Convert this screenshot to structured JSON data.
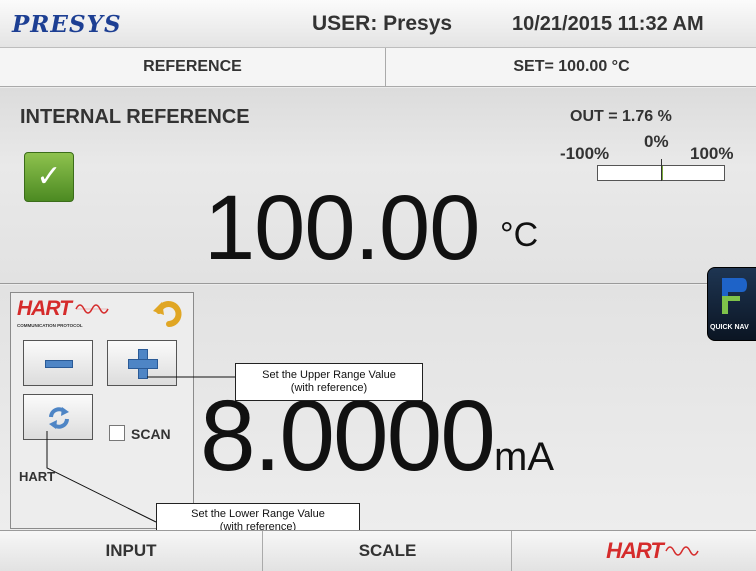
{
  "header": {
    "brand": "PRESYS",
    "user": "USER: Presys",
    "datetime": "10/21/2015 11:32 AM"
  },
  "subbar": {
    "reference_label": "REFERENCE",
    "set_label": "SET= 100.00 °C"
  },
  "reference": {
    "title": "INTERNAL REFERENCE",
    "value": "100.00",
    "unit": "°C",
    "out_label": "OUT = 1.76 %",
    "out_percent": 1.76,
    "scale_min": "-100%",
    "scale_zero": "0%",
    "scale_max": "100%",
    "status_icon": "check-icon"
  },
  "quicknav": {
    "label": "QUICK NAV"
  },
  "hart_panel": {
    "logo_text": "HART",
    "logo_subtext": "COMMUNICATION PROTOCOL",
    "scan_label": "SCAN",
    "scan_checked": false,
    "hart_label": "HART",
    "icons": [
      "back-icon",
      "minus-icon",
      "plus-icon",
      "refresh-icon"
    ]
  },
  "output": {
    "value": "8.0000",
    "unit": "mA"
  },
  "callouts": {
    "upper": "Set the Upper Range Value\n(with reference)",
    "lower": "Set the Lower Range Value\n(with reference)"
  },
  "bottom_nav": {
    "input": "INPUT",
    "scale": "SCALE",
    "hart": "HART"
  },
  "colors": {
    "brand": "#1d3f93",
    "hart_red": "#d52b2b",
    "button_blue": "#4e85c5",
    "check_green": "#4c8a22"
  }
}
